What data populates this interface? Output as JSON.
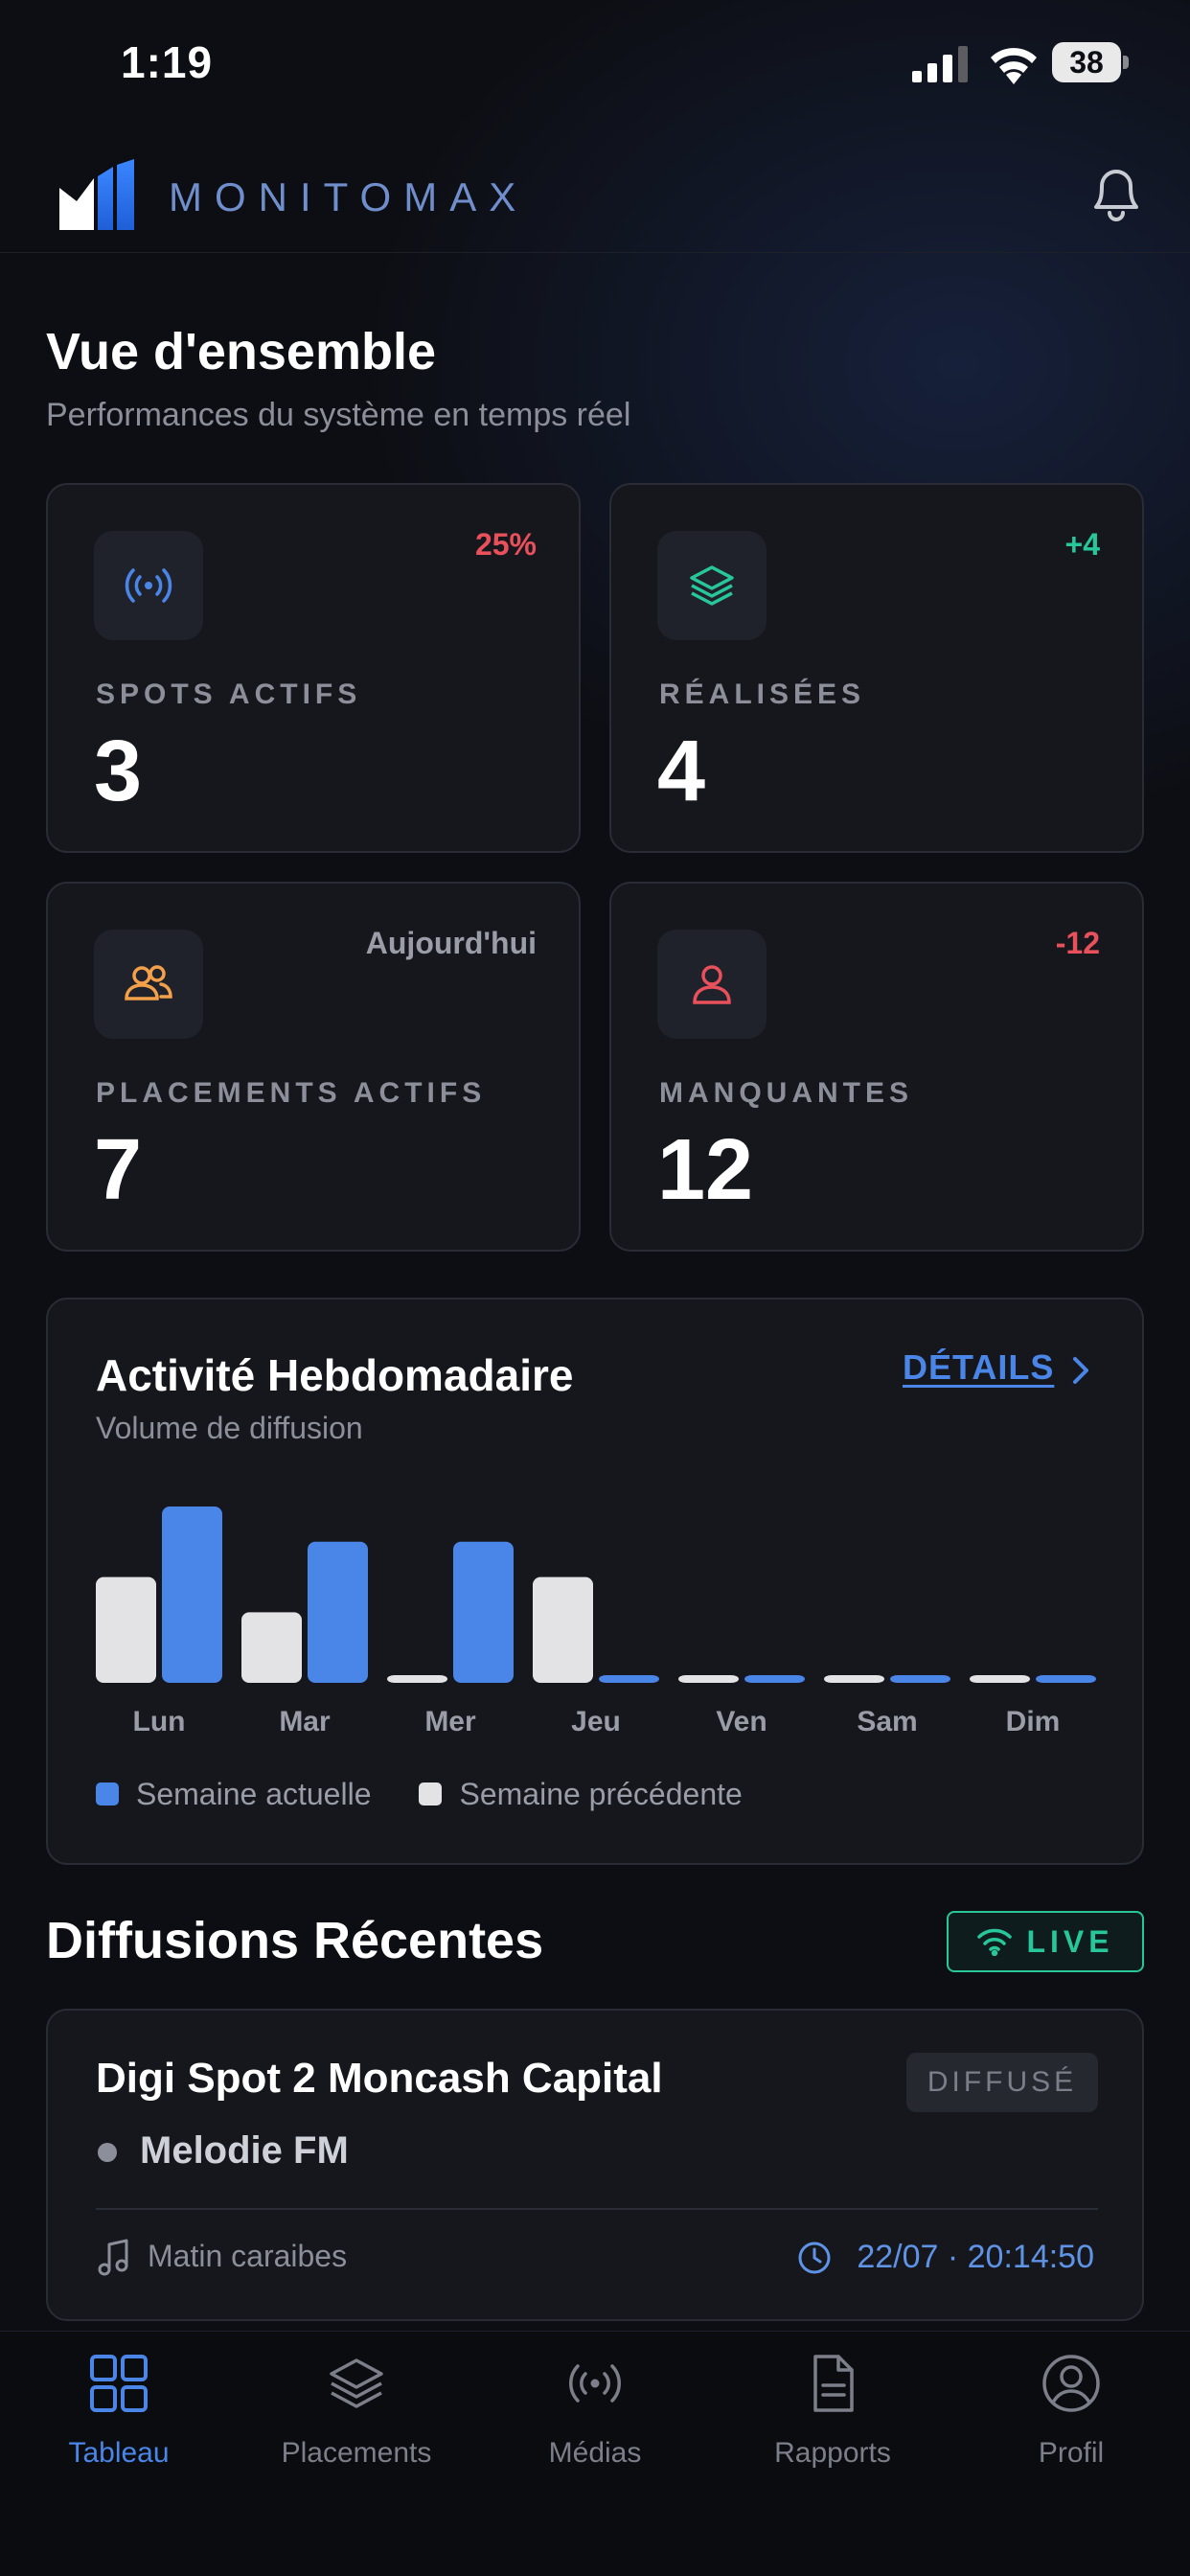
{
  "status_bar": {
    "time": "1:19",
    "battery": "38"
  },
  "header": {
    "brand": "MONITOMAX"
  },
  "overview": {
    "title": "Vue d'ensemble",
    "subtitle": "Performances du système en temps réel"
  },
  "stats": [
    {
      "label": "SPOTS ACTIFS",
      "value": "3",
      "badge": "25%",
      "icon": "broadcast-icon",
      "icon_color": "#4a86e8",
      "badge_color": "#e8505b"
    },
    {
      "label": "RÉALISÉES",
      "value": "4",
      "badge": "+4",
      "icon": "layers-icon",
      "icon_color": "#27c79a",
      "badge_color": "#27c79a"
    },
    {
      "label": "PLACEMENTS ACTIFS",
      "value": "7",
      "badge": "Aujourd'hui",
      "icon": "users-icon",
      "icon_color": "#f2a04a",
      "badge_color": "#9a9da8"
    },
    {
      "label": "MANQUANTES",
      "value": "12",
      "badge": "-12",
      "icon": "user-icon",
      "icon_color": "#e8505b",
      "badge_color": "#e8505b"
    }
  ],
  "chart_card": {
    "title": "Activité Hebdomadaire",
    "subtitle": "Volume de diffusion",
    "details_label": "DÉTAILS"
  },
  "chart_data": {
    "type": "bar",
    "categories": [
      "Lun",
      "Mar",
      "Mer",
      "Jeu",
      "Ven",
      "Sam",
      "Dim"
    ],
    "series": [
      {
        "name": "Semaine précédente",
        "color": "#e3e3e6",
        "values": [
          3,
          2,
          0,
          3,
          0,
          0,
          0
        ]
      },
      {
        "name": "Semaine actuelle",
        "color": "#4a86e8",
        "values": [
          5,
          4,
          4,
          0,
          0,
          0,
          0
        ]
      }
    ],
    "ylim": [
      0,
      5
    ],
    "grid": false,
    "legend": "bottom-left",
    "legend_order": [
      "Semaine actuelle",
      "Semaine précédente"
    ]
  },
  "recent": {
    "title": "Diffusions Récentes",
    "live_label": "LIVE",
    "items": [
      {
        "title": "Digi Spot 2 Moncash Capital",
        "status": "DIFFUSÉ",
        "station": "Melodie FM",
        "show": "Matin caraibes",
        "datetime": "22/07 · 20:14:50"
      }
    ]
  },
  "nav": {
    "items": [
      {
        "label": "Tableau",
        "icon": "grid-icon",
        "active": true
      },
      {
        "label": "Placements",
        "icon": "layers-icon",
        "active": false
      },
      {
        "label": "Médias",
        "icon": "broadcast-icon",
        "active": false
      },
      {
        "label": "Rapports",
        "icon": "document-icon",
        "active": false
      },
      {
        "label": "Profil",
        "icon": "profile-icon",
        "active": false
      }
    ]
  },
  "colors": {
    "accent": "#4a86e8",
    "success": "#27c79a",
    "danger": "#e8505b",
    "warning": "#f2a04a"
  }
}
